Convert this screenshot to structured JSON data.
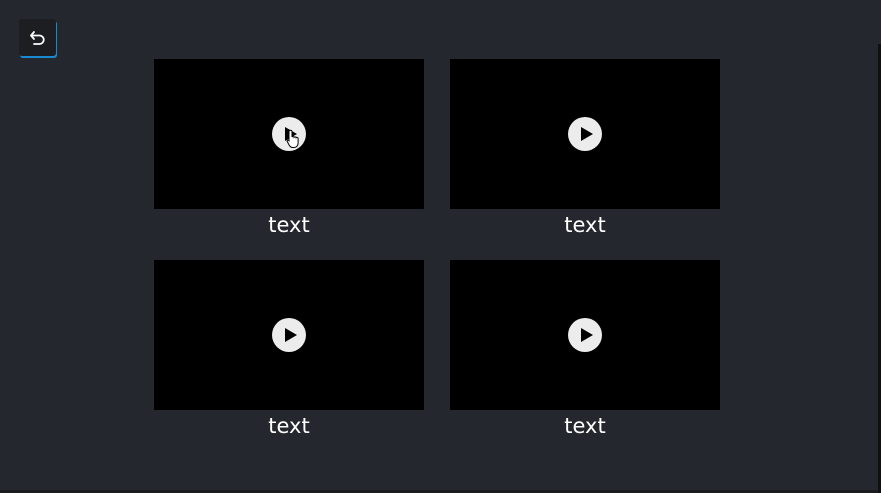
{
  "back_button": {
    "icon": "undo-icon"
  },
  "videos": [
    {
      "caption": "text",
      "icon": "play-icon"
    },
    {
      "caption": "text",
      "icon": "play-icon"
    },
    {
      "caption": "text",
      "icon": "play-icon"
    },
    {
      "caption": "text",
      "icon": "play-icon"
    }
  ],
  "colors": {
    "background": "#24272d",
    "thumbnail": "#000000",
    "play_button": "#ececec",
    "accent": "#1a8ad0",
    "caption": "#ffffff"
  }
}
